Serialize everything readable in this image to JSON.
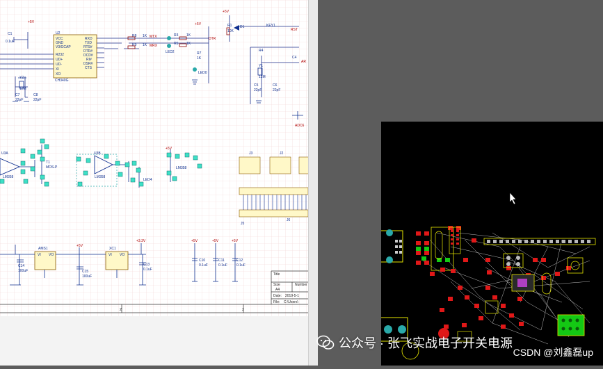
{
  "schematic": {
    "chip_u2": {
      "ref": "U2",
      "part": "CH340G",
      "left_pins": [
        "VCC",
        "GND",
        "V3/GCAP",
        "R232",
        "UD+",
        "UD-",
        "XI",
        "XO"
      ],
      "right_pins": [
        "RXD",
        "TXD",
        "RTS#",
        "DTR#",
        "DCD#",
        "RI#",
        "DSR#",
        "CTS"
      ]
    },
    "labels": {
      "c1": "C1",
      "c1v": "0.1uF",
      "vcc": "+5V",
      "y2": "Y2",
      "y2v": "12M",
      "c7": "C7",
      "c7v": "22pF",
      "c8": "C8",
      "c8v": "22pF",
      "r8": "R8",
      "r9": "R9",
      "r8v": "1K",
      "r9v": "1K",
      "mtx": "MTX",
      "mrx": "MRX",
      "r3": "R3",
      "r5": "R5",
      "r3v": "1K",
      "r5v": "1K",
      "led2": "LED2",
      "r7": "R7",
      "r7v": "1K",
      "led0": "LED0",
      "r1": "R1",
      "r1v": "10K",
      "d1": "D1",
      "key": "KEY1",
      "rst": "RST",
      "dtr": "DTR",
      "r4": "R4",
      "c4": "C4",
      "y1": "Y1",
      "y1v": "12M",
      "c5": "C5",
      "c6": "C6",
      "c5v": "22pF",
      "c6v": "22pF",
      "ar": "AR",
      "adc6": "ADC6",
      "u3a": "U3A",
      "u3b": "U3B",
      "t1": "T1",
      "t1v": "MOS-P",
      "lm358": "LM358",
      "lm358b": "LM358",
      "led4": "LED4",
      "j3": "J3",
      "j2": "J2",
      "j5": "J5",
      "j6": "J6",
      "ams1": "AMS1",
      "xc1": "XC1",
      "vi": "VI",
      "vo": "VO",
      "p33": "+3.3V",
      "c14": "C14",
      "c14v": "100uF",
      "c15": "C15",
      "c15v": "100uF",
      "c13": "C13",
      "c13v": "0.1uF",
      "c10": "C10",
      "c11": "C11",
      "c12": "C12",
      "c10v": "0.1uF",
      "c11v": "0.1uF",
      "c12v": "0.1uF",
      "title": "Title",
      "size": "Size",
      "size_v": "A4",
      "number": "Number",
      "date": "Date:",
      "date_v": "2019-5-1",
      "file": "File:",
      "file_v": "C:\\Users\\",
      "col2": "2",
      "col3": "3"
    }
  },
  "watermark": {
    "text": "公众号 · 张飞实战电子开关电源"
  },
  "credit": {
    "text": "CSDN @刘鑫磊up"
  }
}
